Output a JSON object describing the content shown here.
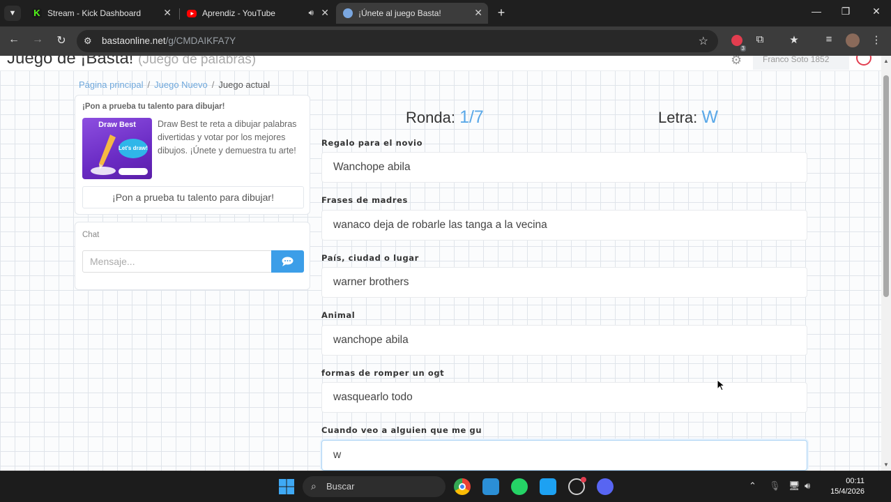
{
  "browser": {
    "tabs": [
      {
        "title": "Stream - Kick Dashboard",
        "favicon": "kick-logo-icon",
        "color": "#53fc18"
      },
      {
        "title": "Aprendiz - YouTube",
        "favicon": "youtube-logo-icon",
        "color": "#ff0000"
      },
      {
        "title": "¡Únete al juego Basta!",
        "favicon": "basta-logo-icon",
        "color": "#7aa7e0"
      }
    ],
    "url_host": "bastaonline.net",
    "url_path": "/g/CMDAIKFA7Y",
    "extension_badge": "3"
  },
  "page": {
    "title": "Juego de ¡Basta!",
    "subtitle": "(Juego de palabras)",
    "user_name": "Franco Soto 1852",
    "breadcrumb": [
      "Página principal",
      "Juego Nuevo",
      "Juego actual"
    ],
    "promo": {
      "heading": "¡Pon a prueba tu talento para dibujar!",
      "image_label": "Draw Best",
      "image_badge": "Let's draw!",
      "text": "Draw Best te reta a dibujar palabras divertidas y votar por los mejores dibujos. ¡Únete y demuestra tu arte!",
      "button": "¡Pon a prueba tu talento para dibujar!"
    },
    "chat": {
      "title": "Chat",
      "placeholder": "Mensaje..."
    },
    "round_label": "Ronda:",
    "round_value": "1/7",
    "letter_label": "Letra:",
    "letter_value": "W",
    "categories": [
      {
        "label": "Regalo para el novio",
        "answer": "Wanchope abila"
      },
      {
        "label": "Frases de madres",
        "answer": "wanaco deja de robarle las tanga a la vecina"
      },
      {
        "label": "País, ciudad o lugar",
        "answer": "warner brothers"
      },
      {
        "label": "Animal",
        "answer": "wanchope abila"
      },
      {
        "label": "formas de romper un ogt",
        "answer": "wasquearlo todo"
      },
      {
        "label": "Cuando veo a alguien que me gu",
        "answer": "w"
      }
    ]
  },
  "taskbar": {
    "search_label": "Buscar",
    "time": "00:11",
    "date": "15/4/2026"
  },
  "colors": {
    "accent": "#5aa8e8",
    "chat_send": "#3c9ee8",
    "power": "#e23d4f"
  }
}
